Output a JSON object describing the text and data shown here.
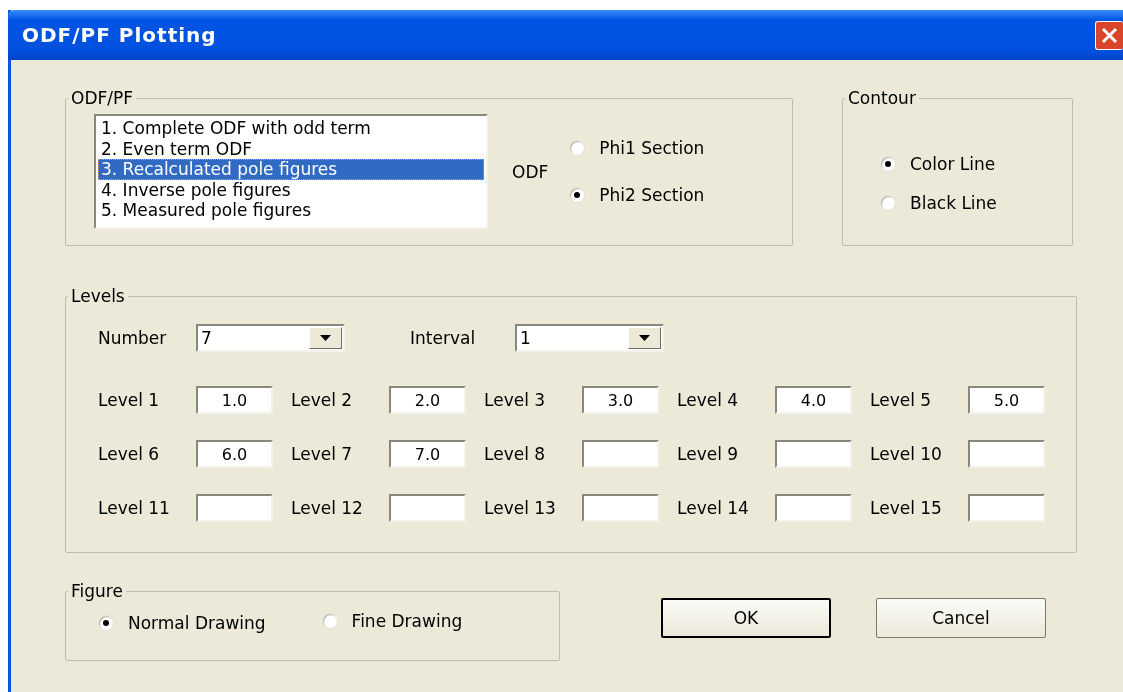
{
  "window": {
    "title": "ODF/PF Plotting"
  },
  "odf_pf": {
    "label": "ODF/PF",
    "list": [
      {
        "text": "1. Complete ODF with odd term",
        "selected": false
      },
      {
        "text": "2. Even term ODF",
        "selected": false
      },
      {
        "text": "3. Recalculated pole figures",
        "selected": true
      },
      {
        "text": "4. Inverse pole figures",
        "selected": false
      },
      {
        "text": "5. Measured pole figures",
        "selected": false
      }
    ],
    "odf_label": "ODF",
    "odf_options": [
      {
        "label": "Phi1 Section",
        "selected": false
      },
      {
        "label": "Phi2 Section",
        "selected": true
      }
    ]
  },
  "contour": {
    "label": "Contour",
    "options": [
      {
        "label": "Color Line",
        "selected": true
      },
      {
        "label": "Black Line",
        "selected": false
      }
    ]
  },
  "levels": {
    "label": "Levels",
    "number": {
      "label": "Number",
      "value": "7"
    },
    "interval": {
      "label": "Interval",
      "value": "1"
    },
    "fields": [
      {
        "label": "Level 1",
        "value": "1.0"
      },
      {
        "label": "Level 2",
        "value": "2.0"
      },
      {
        "label": "Level 3",
        "value": "3.0"
      },
      {
        "label": "Level 4",
        "value": "4.0"
      },
      {
        "label": "Level 5",
        "value": "5.0"
      },
      {
        "label": "Level 6",
        "value": "6.0"
      },
      {
        "label": "Level 7",
        "value": "7.0"
      },
      {
        "label": "Level 8"
      },
      {
        "label": "Level 9"
      },
      {
        "label": "Level 10"
      },
      {
        "label": "Level 11"
      },
      {
        "label": "Level 12"
      },
      {
        "label": "Level 13"
      },
      {
        "label": "Level 14"
      },
      {
        "label": "Level 15"
      }
    ]
  },
  "figure": {
    "label": "Figure",
    "options": [
      {
        "label": "Normal Drawing",
        "selected": true
      },
      {
        "label": "Fine Drawing",
        "selected": false
      }
    ]
  },
  "buttons": [
    {
      "label": "OK",
      "default": true
    },
    {
      "label": "Cancel",
      "default": false
    }
  ]
}
